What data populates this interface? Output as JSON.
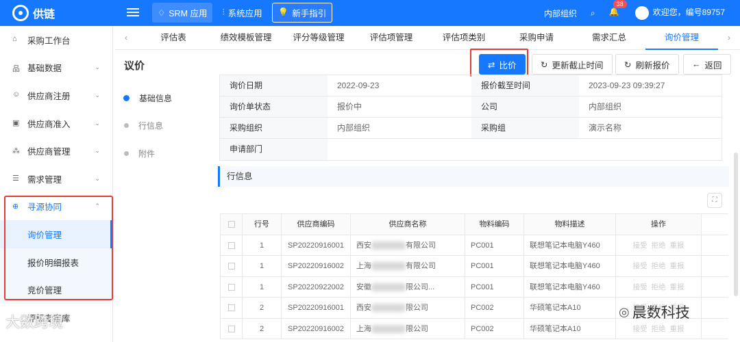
{
  "app": {
    "title": "供链"
  },
  "topnav": {
    "items": [
      {
        "label": "SRM 应用",
        "icon": "rocket-icon"
      },
      {
        "label": "系统应用",
        "icon": "sliders-icon"
      },
      {
        "label": "新手指引",
        "icon": "lightbulb-icon"
      }
    ],
    "org": "内部组织",
    "notification_count": "38",
    "welcome": "欢迎您，编号89757"
  },
  "sidebar": {
    "items": [
      {
        "label": "采购工作台",
        "icon": "home-icon"
      },
      {
        "label": "基础数据",
        "icon": "hierarchy-icon"
      },
      {
        "label": "供应商注册",
        "icon": "user-icon"
      },
      {
        "label": "供应商准入",
        "icon": "id-card-icon"
      },
      {
        "label": "供应商管理",
        "icon": "network-icon"
      },
      {
        "label": "需求管理",
        "icon": "list-icon"
      },
      {
        "label": "寻源协同",
        "icon": "globe-icon"
      }
    ],
    "sub_items": [
      "询价管理",
      "报价明细报表",
      "竞价管理"
    ],
    "last_item": "评标专家库"
  },
  "tabs": [
    "评估表",
    "绩效模板管理",
    "评分等级管理",
    "评估项管理",
    "评估项类别",
    "采购申请",
    "需求汇总",
    "询价管理"
  ],
  "page": {
    "title": "议价",
    "buttons": {
      "compare": "比价",
      "update_deadline": "更新截止时间",
      "refresh": "刷新报价",
      "back": "返回"
    }
  },
  "anchors": [
    "基础信息",
    "行信息",
    "附件"
  ],
  "info": {
    "rows": [
      [
        {
          "label": "询价日期",
          "value": "2022-09-23"
        },
        {
          "label": "报价截至时间",
          "value": "2023-09-23 09:39:27"
        }
      ],
      [
        {
          "label": "询价单状态",
          "value": "报价中"
        },
        {
          "label": "公司",
          "value": "内部组织"
        }
      ],
      [
        {
          "label": "采购组织",
          "value": "内部组织"
        },
        {
          "label": "采购组",
          "value": "演示名称"
        }
      ]
    ],
    "dept_label": "申请部门",
    "dept_value": ""
  },
  "section": {
    "title": "行信息"
  },
  "grid": {
    "headers": [
      "行号",
      "供应商编码",
      "供应商名称",
      "物料编码",
      "物料描述",
      "操作"
    ],
    "ops": [
      "接受",
      "拒绝",
      "重报"
    ],
    "rows": [
      {
        "line": "1",
        "code": "SP20220916001",
        "name_prefix": "西安",
        "name_suffix": "有限公司",
        "material": "PC001",
        "desc": "联想笔记本电脑Y460"
      },
      {
        "line": "1",
        "code": "SP20220916002",
        "name_prefix": "上海",
        "name_suffix": "有限公司",
        "material": "PC001",
        "desc": "联想笔记本电脑Y460"
      },
      {
        "line": "1",
        "code": "SP20220922002",
        "name_prefix": "安徽",
        "name_suffix": "限公司...",
        "material": "PC001",
        "desc": "联想笔记本电脑Y460"
      },
      {
        "line": "2",
        "code": "SP20220916001",
        "name_prefix": "西安",
        "name_suffix": "限公司",
        "material": "PC002",
        "desc": "华硕笔记本A10"
      },
      {
        "line": "2",
        "code": "SP20220916002",
        "name_prefix": "上海",
        "name_suffix": "限公司",
        "material": "PC002",
        "desc": "华硕笔记本A10"
      }
    ]
  },
  "watermarks": {
    "left": "大数跨境",
    "right": "晨数科技"
  },
  "colors": {
    "primary": "#1677ff",
    "highlight": "#e53935"
  }
}
